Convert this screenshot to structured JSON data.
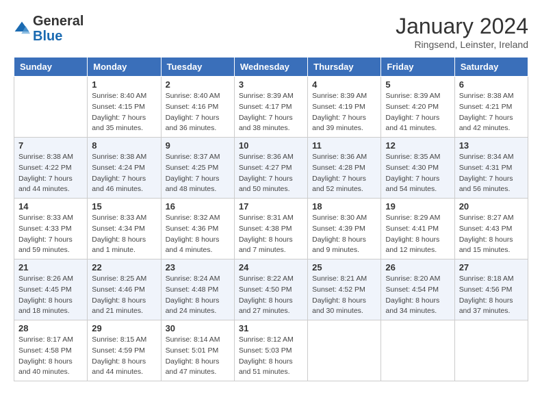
{
  "logo": {
    "general": "General",
    "blue": "Blue"
  },
  "header": {
    "month_title": "January 2024",
    "subtitle": "Ringsend, Leinster, Ireland"
  },
  "weekdays": [
    "Sunday",
    "Monday",
    "Tuesday",
    "Wednesday",
    "Thursday",
    "Friday",
    "Saturday"
  ],
  "weeks": [
    [
      {
        "day": "",
        "info": ""
      },
      {
        "day": "1",
        "info": "Sunrise: 8:40 AM\nSunset: 4:15 PM\nDaylight: 7 hours\nand 35 minutes."
      },
      {
        "day": "2",
        "info": "Sunrise: 8:40 AM\nSunset: 4:16 PM\nDaylight: 7 hours\nand 36 minutes."
      },
      {
        "day": "3",
        "info": "Sunrise: 8:39 AM\nSunset: 4:17 PM\nDaylight: 7 hours\nand 38 minutes."
      },
      {
        "day": "4",
        "info": "Sunrise: 8:39 AM\nSunset: 4:19 PM\nDaylight: 7 hours\nand 39 minutes."
      },
      {
        "day": "5",
        "info": "Sunrise: 8:39 AM\nSunset: 4:20 PM\nDaylight: 7 hours\nand 41 minutes."
      },
      {
        "day": "6",
        "info": "Sunrise: 8:38 AM\nSunset: 4:21 PM\nDaylight: 7 hours\nand 42 minutes."
      }
    ],
    [
      {
        "day": "7",
        "info": "Sunrise: 8:38 AM\nSunset: 4:22 PM\nDaylight: 7 hours\nand 44 minutes."
      },
      {
        "day": "8",
        "info": "Sunrise: 8:38 AM\nSunset: 4:24 PM\nDaylight: 7 hours\nand 46 minutes."
      },
      {
        "day": "9",
        "info": "Sunrise: 8:37 AM\nSunset: 4:25 PM\nDaylight: 7 hours\nand 48 minutes."
      },
      {
        "day": "10",
        "info": "Sunrise: 8:36 AM\nSunset: 4:27 PM\nDaylight: 7 hours\nand 50 minutes."
      },
      {
        "day": "11",
        "info": "Sunrise: 8:36 AM\nSunset: 4:28 PM\nDaylight: 7 hours\nand 52 minutes."
      },
      {
        "day": "12",
        "info": "Sunrise: 8:35 AM\nSunset: 4:30 PM\nDaylight: 7 hours\nand 54 minutes."
      },
      {
        "day": "13",
        "info": "Sunrise: 8:34 AM\nSunset: 4:31 PM\nDaylight: 7 hours\nand 56 minutes."
      }
    ],
    [
      {
        "day": "14",
        "info": "Sunrise: 8:33 AM\nSunset: 4:33 PM\nDaylight: 7 hours\nand 59 minutes."
      },
      {
        "day": "15",
        "info": "Sunrise: 8:33 AM\nSunset: 4:34 PM\nDaylight: 8 hours\nand 1 minute."
      },
      {
        "day": "16",
        "info": "Sunrise: 8:32 AM\nSunset: 4:36 PM\nDaylight: 8 hours\nand 4 minutes."
      },
      {
        "day": "17",
        "info": "Sunrise: 8:31 AM\nSunset: 4:38 PM\nDaylight: 8 hours\nand 7 minutes."
      },
      {
        "day": "18",
        "info": "Sunrise: 8:30 AM\nSunset: 4:39 PM\nDaylight: 8 hours\nand 9 minutes."
      },
      {
        "day": "19",
        "info": "Sunrise: 8:29 AM\nSunset: 4:41 PM\nDaylight: 8 hours\nand 12 minutes."
      },
      {
        "day": "20",
        "info": "Sunrise: 8:27 AM\nSunset: 4:43 PM\nDaylight: 8 hours\nand 15 minutes."
      }
    ],
    [
      {
        "day": "21",
        "info": "Sunrise: 8:26 AM\nSunset: 4:45 PM\nDaylight: 8 hours\nand 18 minutes."
      },
      {
        "day": "22",
        "info": "Sunrise: 8:25 AM\nSunset: 4:46 PM\nDaylight: 8 hours\nand 21 minutes."
      },
      {
        "day": "23",
        "info": "Sunrise: 8:24 AM\nSunset: 4:48 PM\nDaylight: 8 hours\nand 24 minutes."
      },
      {
        "day": "24",
        "info": "Sunrise: 8:22 AM\nSunset: 4:50 PM\nDaylight: 8 hours\nand 27 minutes."
      },
      {
        "day": "25",
        "info": "Sunrise: 8:21 AM\nSunset: 4:52 PM\nDaylight: 8 hours\nand 30 minutes."
      },
      {
        "day": "26",
        "info": "Sunrise: 8:20 AM\nSunset: 4:54 PM\nDaylight: 8 hours\nand 34 minutes."
      },
      {
        "day": "27",
        "info": "Sunrise: 8:18 AM\nSunset: 4:56 PM\nDaylight: 8 hours\nand 37 minutes."
      }
    ],
    [
      {
        "day": "28",
        "info": "Sunrise: 8:17 AM\nSunset: 4:58 PM\nDaylight: 8 hours\nand 40 minutes."
      },
      {
        "day": "29",
        "info": "Sunrise: 8:15 AM\nSunset: 4:59 PM\nDaylight: 8 hours\nand 44 minutes."
      },
      {
        "day": "30",
        "info": "Sunrise: 8:14 AM\nSunset: 5:01 PM\nDaylight: 8 hours\nand 47 minutes."
      },
      {
        "day": "31",
        "info": "Sunrise: 8:12 AM\nSunset: 5:03 PM\nDaylight: 8 hours\nand 51 minutes."
      },
      {
        "day": "",
        "info": ""
      },
      {
        "day": "",
        "info": ""
      },
      {
        "day": "",
        "info": ""
      }
    ]
  ]
}
